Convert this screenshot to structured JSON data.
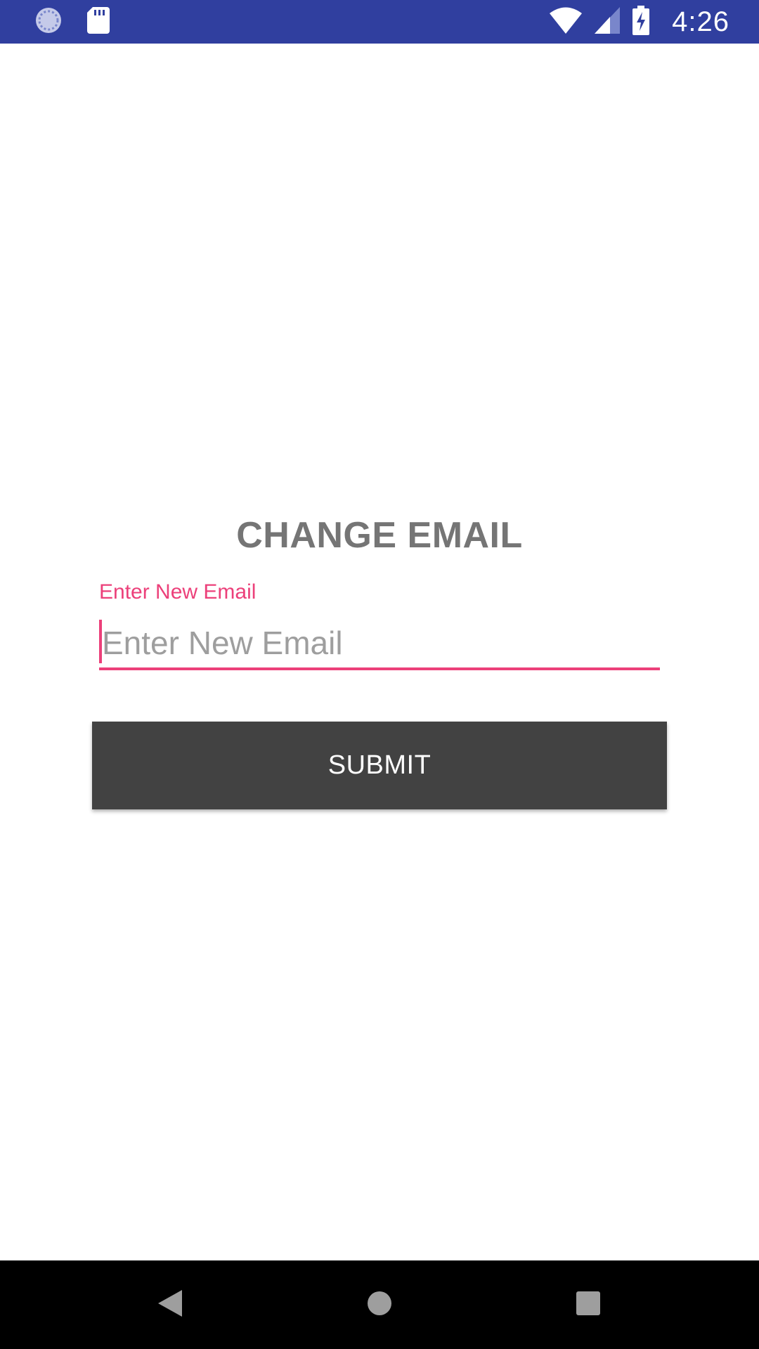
{
  "status_bar": {
    "time": "4:26",
    "background_color": "#303f9f",
    "left_icons": [
      "sync-icon",
      "sd-card-icon"
    ],
    "right_icons": [
      "wifi-icon",
      "cell-signal-icon",
      "battery-charging-icon"
    ]
  },
  "page": {
    "title": "CHANGE EMAIL"
  },
  "email_field": {
    "floating_label": "Enter New Email",
    "placeholder": "Enter New Email",
    "value": "",
    "accent_color": "#ec407a"
  },
  "submit_button": {
    "label": "SUBMIT",
    "background_color": "#424242"
  },
  "nav_bar": {
    "buttons": [
      "back-icon",
      "home-icon",
      "recents-icon"
    ]
  }
}
